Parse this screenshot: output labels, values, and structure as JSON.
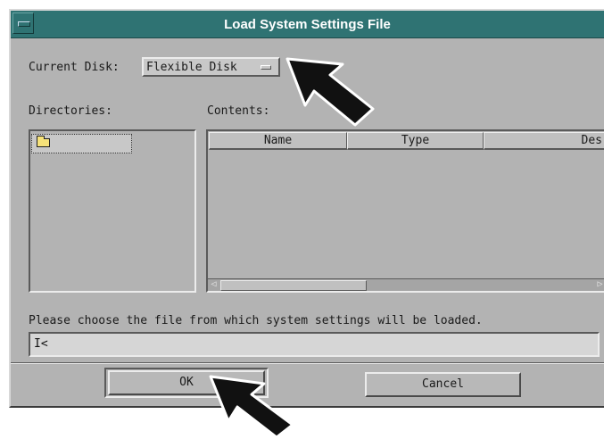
{
  "window": {
    "title": "Load System Settings File"
  },
  "current_disk": {
    "label": "Current Disk:",
    "value": "Flexible Disk"
  },
  "directories": {
    "label": "Directories:",
    "items": [
      {
        "icon": "folder-icon",
        "label": ""
      }
    ]
  },
  "contents": {
    "label": "Contents:",
    "columns": [
      "Name",
      "Type",
      "Des"
    ],
    "rows": []
  },
  "prompt": {
    "text": "Please choose the file from which system settings will be loaded."
  },
  "filename": {
    "value": ""
  },
  "buttons": {
    "ok": "OK",
    "cancel": "Cancel"
  },
  "colors": {
    "titlebar": "#2f7373",
    "dialog_bg": "#b3b3b3",
    "folder": "#f6e27a"
  }
}
